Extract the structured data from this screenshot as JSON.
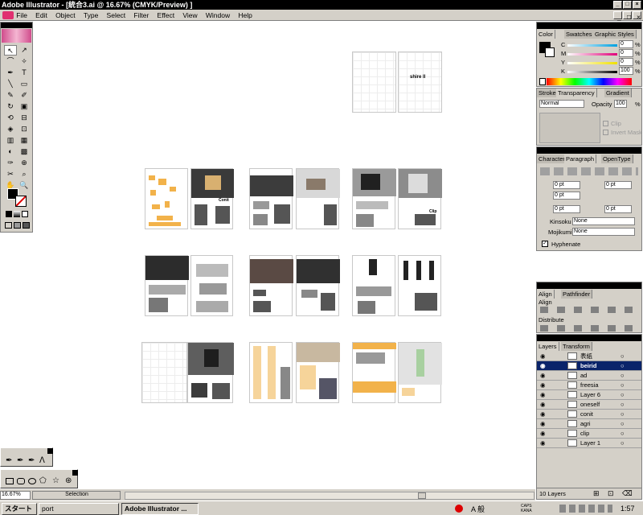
{
  "window": {
    "title": "Adobe Illustrator - [統合3.ai @ 16.67% (CMYK/Preview) ]",
    "controls": [
      "_",
      "□",
      "×"
    ]
  },
  "menu": [
    "File",
    "Edit",
    "Object",
    "Type",
    "Select",
    "Filter",
    "Effect",
    "View",
    "Window",
    "Help"
  ],
  "color_panel": {
    "tabs": [
      "Color",
      "Swatches",
      "Graphic Styles"
    ],
    "channels": [
      {
        "label": "C",
        "value": "0",
        "unit": "%"
      },
      {
        "label": "M",
        "value": "0",
        "unit": "%"
      },
      {
        "label": "Y",
        "value": "0",
        "unit": "%"
      },
      {
        "label": "K",
        "value": "100",
        "unit": "%"
      }
    ]
  },
  "transparency_panel": {
    "tabs": [
      "Stroke",
      "Transparency",
      "Gradient"
    ],
    "mode": "Normal",
    "opacity_label": "Opacity",
    "opacity_value": "100",
    "opacity_unit": "%",
    "clip_label": "Clip",
    "invert_label": "Invert Mask"
  },
  "paragraph_panel": {
    "tabs": [
      "Character",
      "Paragraph",
      "OpenType"
    ],
    "fields": [
      "0 pt",
      "0 pt",
      "0 pt",
      "0 pt",
      "0 pt"
    ],
    "kinsoku_label": "Kinsoku",
    "kinsoku_value": "None",
    "mojikumi_label": "Mojikumi",
    "mojikumi_value": "None",
    "hyphenate_label": "Hyphenate"
  },
  "align_panel": {
    "tabs": [
      "Align",
      "Pathfinder"
    ],
    "align_label": "Align",
    "distribute_label": "Distribute"
  },
  "layers_panel": {
    "tabs": [
      "Layers",
      "Transform"
    ],
    "layers": [
      "表紙",
      "beirid",
      "ad",
      "freesia",
      "Layer 6",
      "oneself",
      "conit",
      "agri",
      "clip",
      "Layer 1"
    ],
    "selected": "beirid",
    "count_label": "10 Layers"
  },
  "artboard": {
    "cover_text": "shire ll",
    "conit_text": "Conit",
    "clip_text": "Clip"
  },
  "status": {
    "zoom": "16.67%",
    "mode": "Selection"
  },
  "taskbar": {
    "start": "スタート",
    "items": [
      "port",
      "Adobe Illustrator ..."
    ],
    "ime": "A 般",
    "caps": "CAPS\nKANA",
    "clock": "1:57"
  },
  "colors": {
    "titlebar": "#000000",
    "selected_layer": "#0a246a",
    "chrome": "#d4d0c8",
    "accent_orange": "#f2b24a"
  }
}
